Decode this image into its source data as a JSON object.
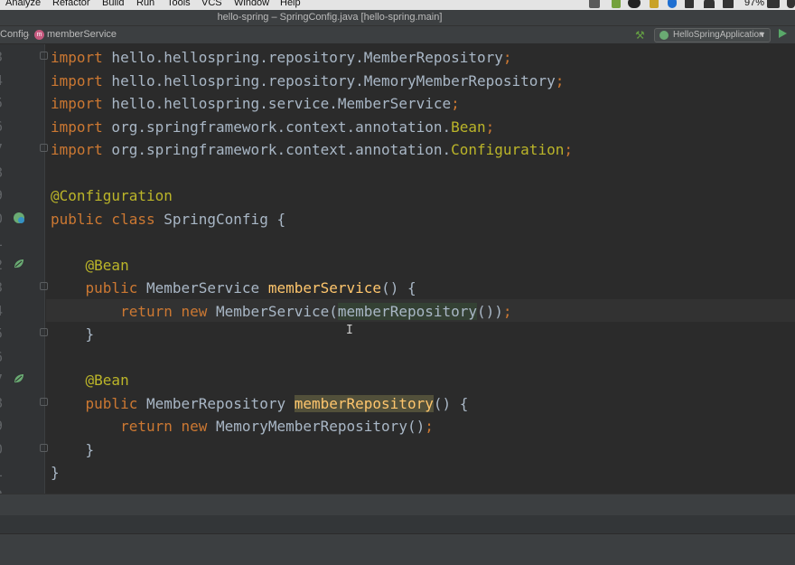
{
  "menubar": {
    "items": [
      "Analyze",
      "Refactor",
      "Build",
      "Run",
      "Tools",
      "VCS",
      "Window",
      "Help"
    ],
    "battery": "97%"
  },
  "window": {
    "title": "hello-spring – SpringConfig.java [hello-spring.main]"
  },
  "navbar": {
    "breadcrumbs": [
      "Config",
      "memberService"
    ],
    "member_badge": "m",
    "run_config": "HelloSpringApplication"
  },
  "editor": {
    "line_numbers": [
      "3",
      "4",
      "5",
      "6",
      "7",
      "8",
      "9",
      "0",
      "1",
      "2",
      "3",
      "4",
      "5",
      "6",
      "7",
      "8",
      "9",
      "0",
      "1",
      "2"
    ],
    "lines": [
      [
        {
          "t": "import",
          "c": "kw"
        },
        {
          "t": " hello.hellospring.repository.MemberRepository"
        },
        {
          "t": ";",
          "c": "kw"
        }
      ],
      [
        {
          "t": "import",
          "c": "kw"
        },
        {
          "t": " hello.hellospring.repository.MemoryMemberRepository"
        },
        {
          "t": ";",
          "c": "kw"
        }
      ],
      [
        {
          "t": "import",
          "c": "kw"
        },
        {
          "t": " hello.hellospring.service.MemberService"
        },
        {
          "t": ";",
          "c": "kw"
        }
      ],
      [
        {
          "t": "import",
          "c": "kw"
        },
        {
          "t": " org.springframework.context.annotation."
        },
        {
          "t": "Bean",
          "c": "ann"
        },
        {
          "t": ";",
          "c": "kw"
        }
      ],
      [
        {
          "t": "import",
          "c": "kw"
        },
        {
          "t": " org.springframework.context.annotation."
        },
        {
          "t": "Configuration",
          "c": "ann"
        },
        {
          "t": ";",
          "c": "kw"
        }
      ],
      [],
      [
        {
          "t": "@Configuration",
          "c": "ann"
        }
      ],
      [
        {
          "t": "public class",
          "c": "kw"
        },
        {
          "t": " SpringConfig {"
        }
      ],
      [],
      [
        {
          "t": "    "
        },
        {
          "t": "@Bean",
          "c": "ann"
        }
      ],
      [
        {
          "t": "    "
        },
        {
          "t": "public",
          "c": "kw"
        },
        {
          "t": " MemberService "
        },
        {
          "t": "memberService",
          "c": "fn"
        },
        {
          "t": "() {"
        }
      ],
      [
        {
          "t": "        "
        },
        {
          "t": "return new",
          "c": "kw"
        },
        {
          "t": " MemberService("
        },
        {
          "t": "memberRepository",
          "c": "hl"
        },
        {
          "t": "())"
        },
        {
          "t": ";",
          "c": "kw"
        }
      ],
      [
        {
          "t": "    }"
        }
      ],
      [],
      [
        {
          "t": "    "
        },
        {
          "t": "@Bean",
          "c": "ann"
        }
      ],
      [
        {
          "t": "    "
        },
        {
          "t": "public",
          "c": "kw"
        },
        {
          "t": " MemberRepository "
        },
        {
          "t": "memberRepository",
          "c": "fn hl2"
        },
        {
          "t": "() {"
        }
      ],
      [
        {
          "t": "        "
        },
        {
          "t": "return new",
          "c": "kw"
        },
        {
          "t": " MemoryMemberRepository()"
        },
        {
          "t": ";",
          "c": "kw"
        }
      ],
      [
        {
          "t": "    }"
        }
      ],
      [
        {
          "t": "}"
        }
      ],
      []
    ],
    "cursor_glyph": "I"
  },
  "colors": {
    "keyword": "#cc7832",
    "annotation": "#bbb529",
    "method": "#ffc66d",
    "text": "#a9b7c6",
    "background": "#2b2b2b"
  },
  "icons": [
    "spring-bean-icon",
    "run-icon",
    "build-hammer-icon"
  ]
}
